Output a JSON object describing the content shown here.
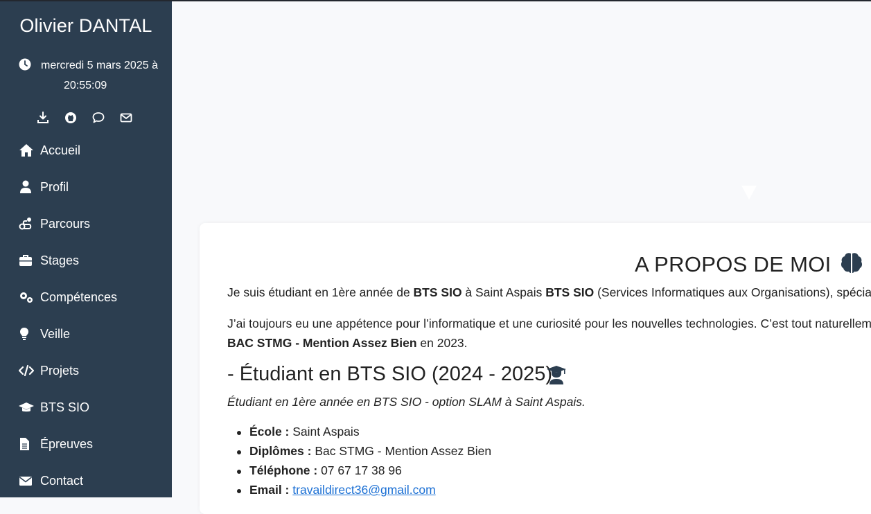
{
  "sidebar": {
    "name": "Olivier DANTAL",
    "date_line1": "mercredi 5 mars 2025 à",
    "date_line2": "20:55:09",
    "social": [
      "download-icon",
      "github-icon",
      "chat-icon",
      "mail-icon"
    ],
    "nav": [
      {
        "label": "Accueil",
        "icon": "home-icon"
      },
      {
        "label": "Profil",
        "icon": "user-icon"
      },
      {
        "label": "Parcours",
        "icon": "route-icon"
      },
      {
        "label": "Stages",
        "icon": "briefcase-icon"
      },
      {
        "label": "Compétences",
        "icon": "gears-icon"
      },
      {
        "label": "Veille",
        "icon": "lightbulb-icon"
      },
      {
        "label": "Projets",
        "icon": "code-icon"
      },
      {
        "label": "BTS SIO",
        "icon": "graduation-cap-icon"
      },
      {
        "label": "Épreuves",
        "icon": "file-icon"
      },
      {
        "label": "Contact",
        "icon": "envelope-icon"
      }
    ]
  },
  "main": {
    "title": "A PROPOS DE MOI",
    "p1": {
      "t1": "Je suis étudiant en 1ère année de ",
      "b1": "BTS SIO",
      "t2": " à Saint Aspais ",
      "b2": "BTS SIO",
      "t3": " (Services Informatiques aux Organisations), spécia"
    },
    "p2": {
      "line1": "J’ai toujours eu une appétence pour l’informatique et une curiosité pour les nouvelles technologies. C’est tout naturellem",
      "b1": "BAC STMG - Mention Assez Bien",
      "t2": " en 2023."
    },
    "section_title": "- Étudiant en BTS SIO (2024 - 2025)",
    "section_subtitle": "Étudiant en 1ère année en BTS SIO - option SLAM à Saint Aspais.",
    "details": [
      {
        "label": "École :",
        "value": " Saint Aspais"
      },
      {
        "label": "Diplômes :",
        "value": " Bac STMG - Mention Assez Bien"
      },
      {
        "label": "Téléphone :",
        "value": " 07 67 17 38 96"
      },
      {
        "label": "Email :",
        "value": "travaildirect36@gmail.com"
      }
    ]
  },
  "colors": {
    "sidebar_bg": "#2c3e50",
    "link": "#1a6fd4",
    "page_bg": "#f8f9fb"
  }
}
